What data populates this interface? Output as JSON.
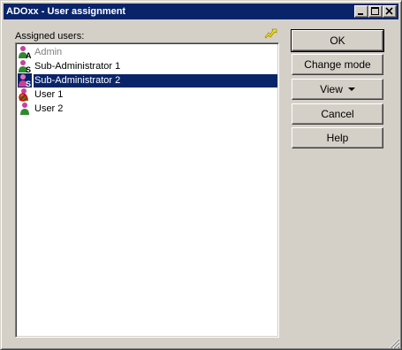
{
  "window": {
    "title": "ADOxx - User assignment"
  },
  "list": {
    "label": "Assigned users:",
    "items": [
      {
        "label": "Admin",
        "icon": "admin-user-icon",
        "state": "disabled"
      },
      {
        "label": "Sub-Administrator 1",
        "icon": "sub-admin-user-icon",
        "state": "normal"
      },
      {
        "label": "Sub-Administrator 2",
        "icon": "sub-admin-user-icon",
        "state": "selected"
      },
      {
        "label": "User 1",
        "icon": "blocked-user-icon",
        "state": "normal"
      },
      {
        "label": "User 2",
        "icon": "user-icon",
        "state": "normal"
      }
    ]
  },
  "buttons": {
    "ok": "OK",
    "change_mode": "Change mode",
    "view": "View",
    "cancel": "Cancel",
    "help": "Help"
  },
  "colors": {
    "titlebar": "#0a246a",
    "selection": "#0a246a",
    "face": "#d4d0c8"
  }
}
